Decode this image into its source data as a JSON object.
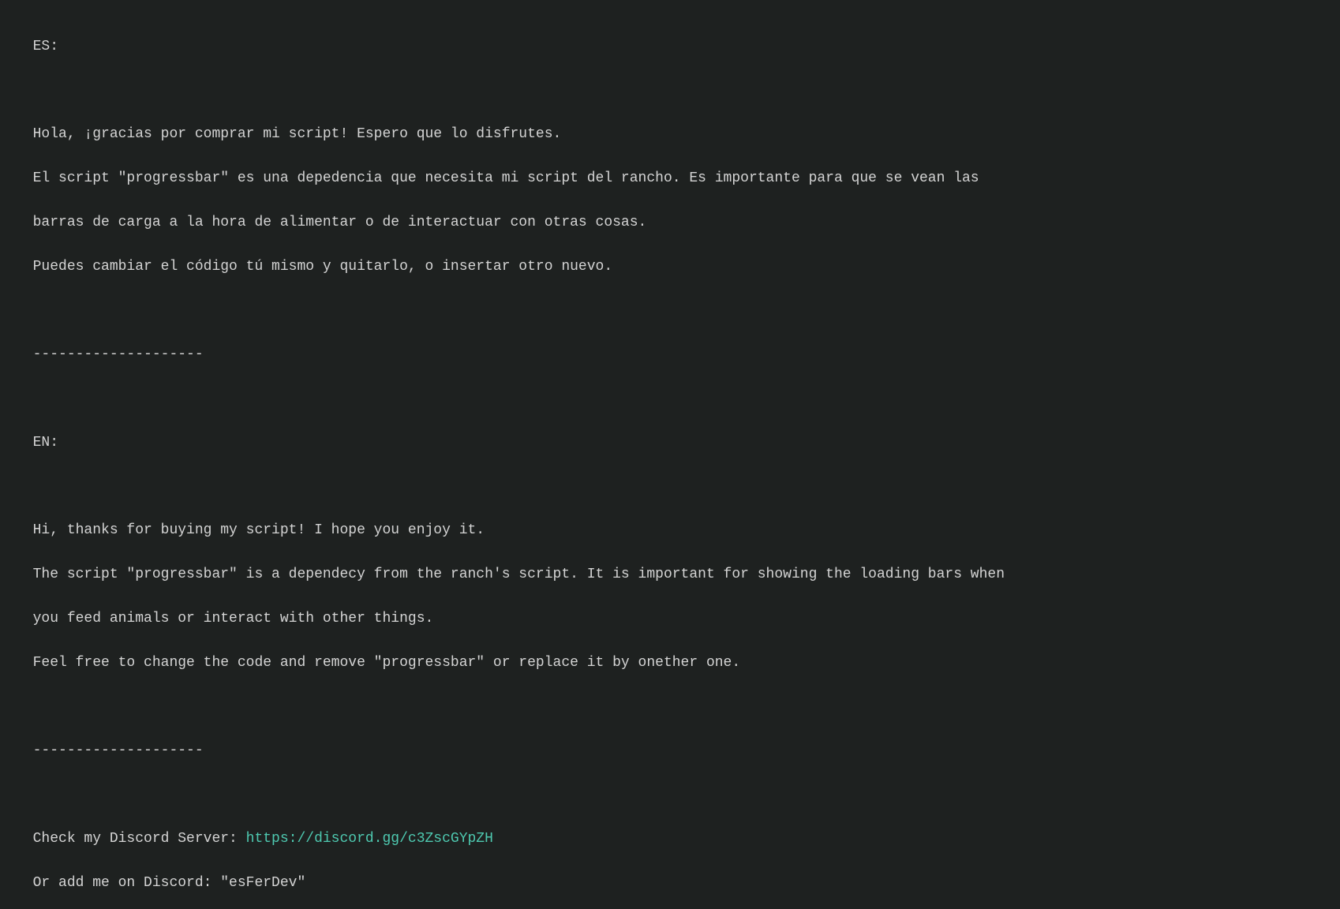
{
  "lines": [
    {
      "id": "es-label",
      "text": "ES:",
      "type": "normal"
    },
    {
      "id": "blank1",
      "text": "",
      "type": "normal"
    },
    {
      "id": "es-line1",
      "text": "Hola, ¡gracias por comprar mi script! Espero que lo disfrutes.",
      "type": "normal"
    },
    {
      "id": "es-line2",
      "text": "El script \"progressbar\" es una depedencia que necesita mi script del rancho. Es importante para que se vean las",
      "type": "normal"
    },
    {
      "id": "es-line3",
      "text": "barras de carga a la hora de alimentar o de interactuar con otras cosas.",
      "type": "normal"
    },
    {
      "id": "es-line4",
      "text": "Puedes cambiar el código tú mismo y quitarlo, o insertar otro nuevo.",
      "type": "normal"
    },
    {
      "id": "blank2",
      "text": "",
      "type": "normal"
    },
    {
      "id": "divider1",
      "text": "--------------------",
      "type": "normal"
    },
    {
      "id": "blank3",
      "text": "",
      "type": "normal"
    },
    {
      "id": "en-label",
      "text": "EN:",
      "type": "normal"
    },
    {
      "id": "blank4",
      "text": "",
      "type": "normal"
    },
    {
      "id": "en-line1",
      "text": "Hi, thanks for buying my script! I hope you enjoy it.",
      "type": "normal"
    },
    {
      "id": "en-line2",
      "text": "The script \"progressbar\" is a dependecy from the ranch's script. It is important for showing the loading bars when",
      "type": "normal"
    },
    {
      "id": "en-line3",
      "text": "you feed animals or interact with other things.",
      "type": "normal"
    },
    {
      "id": "en-line4",
      "text": "Feel free to change the code and remove \"progressbar\" or replace it by onether one.",
      "type": "normal"
    },
    {
      "id": "blank5",
      "text": "",
      "type": "normal"
    },
    {
      "id": "divider2",
      "text": "--------------------",
      "type": "normal"
    },
    {
      "id": "blank6",
      "text": "",
      "type": "normal"
    },
    {
      "id": "discord-line1-prefix",
      "text": "Check my Discord Server: ",
      "type": "normal"
    },
    {
      "id": "discord-link",
      "text": "https://discord.gg/c3ZscGYpZH",
      "type": "link"
    },
    {
      "id": "discord-line2",
      "text": "Or add me on Discord: \"esFerDev\"",
      "type": "normal"
    }
  ],
  "discord": {
    "prefix": "Check my Discord Server: ",
    "url": "https://discord.gg/c3ZscGYpZH",
    "add_prefix": "Or add me on Discord: \"esFerDev\""
  }
}
